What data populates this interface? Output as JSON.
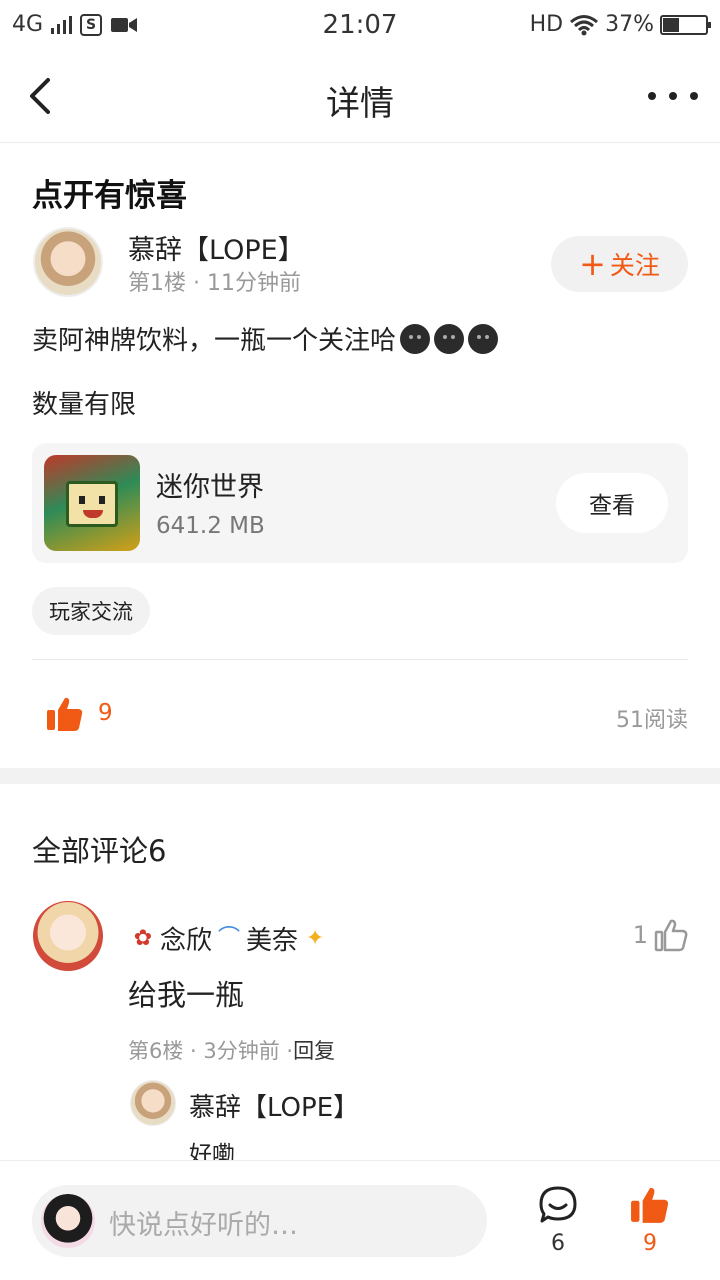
{
  "status_bar": {
    "network": "4G",
    "time": "21:07",
    "hd": "HD",
    "battery": "37%",
    "battery_level": 0.37
  },
  "header": {
    "title": "详情"
  },
  "post": {
    "title": "点开有惊喜",
    "author": "慕辞【LOPE】",
    "meta": "第1楼 · 11分钟前",
    "follow_label": "关注",
    "line1": "卖阿神牌饮料，一瓶一个关注哈",
    "line2": "数量有限",
    "game": {
      "name": "迷你世界",
      "size": "641.2 MB",
      "view_label": "查看"
    },
    "tag": "玩家交流",
    "like_count": "9",
    "read_count": "51阅读"
  },
  "comments": {
    "title": "全部评论6",
    "items": [
      {
        "name_part1": "念欣",
        "name_part2": "美奈",
        "likes": "1",
        "text": "给我一瓶",
        "meta": "第6楼 · 3分钟前 ·",
        "reply_label": "回复",
        "reply": {
          "author": "慕辞【LOPE】",
          "text": "好嘞"
        }
      }
    ]
  },
  "bottom_bar": {
    "placeholder": "快说点好听的…",
    "comment_count": "6",
    "like_count": "9"
  },
  "colors": {
    "accent": "#f05a14"
  }
}
